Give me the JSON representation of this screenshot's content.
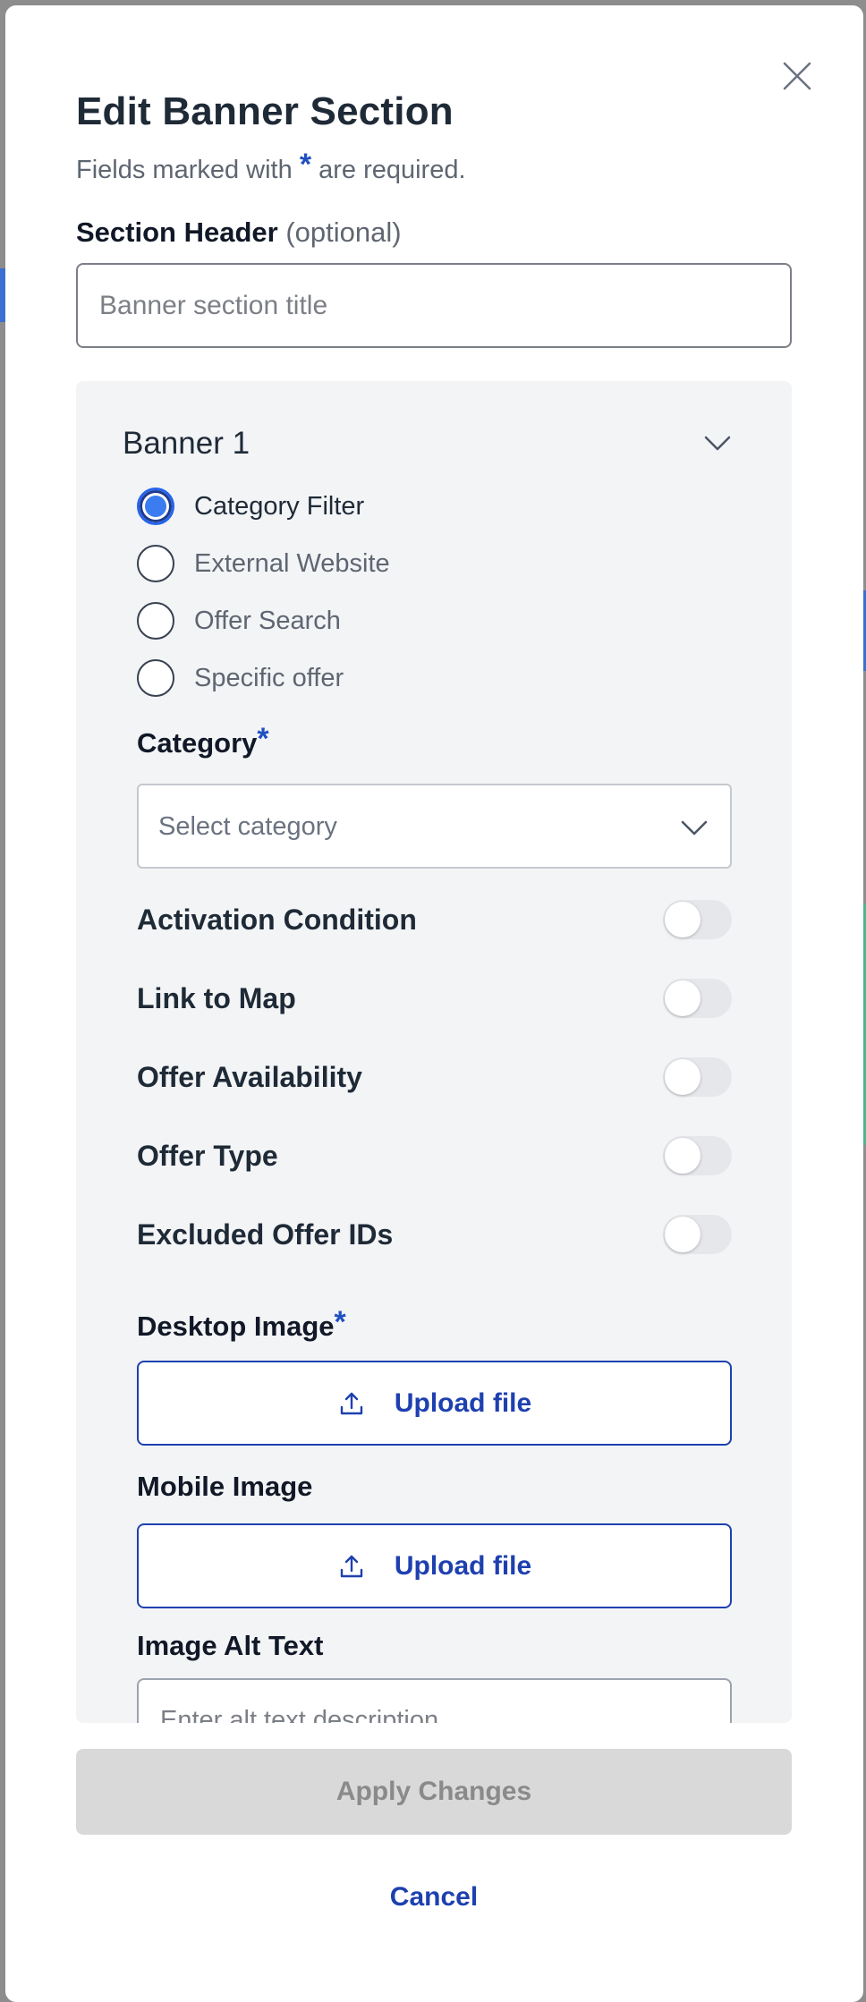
{
  "modal": {
    "title": "Edit Banner Section",
    "subtitle_before": "Fields marked with ",
    "subtitle_star": "*",
    "subtitle_after": " are required."
  },
  "section_header": {
    "label": "Section Header",
    "optional": "(optional)",
    "placeholder": "Banner section title"
  },
  "banner": {
    "title": "Banner 1",
    "radio_options": [
      {
        "label": "Category Filter",
        "checked": true
      },
      {
        "label": "External Website",
        "checked": false
      },
      {
        "label": "Offer Search",
        "checked": false
      },
      {
        "label": "Specific offer",
        "checked": false
      }
    ],
    "category": {
      "label": "Category",
      "required_star": "*",
      "placeholder": "Select category"
    },
    "toggles": [
      {
        "label": "Activation Condition",
        "on": false
      },
      {
        "label": "Link to Map",
        "on": false
      },
      {
        "label": "Offer Availability",
        "on": false
      },
      {
        "label": "Offer Type",
        "on": false
      },
      {
        "label": "Excluded Offer IDs",
        "on": false
      }
    ],
    "desktop_image": {
      "label": "Desktop Image",
      "required_star": "*",
      "button": "Upload file"
    },
    "mobile_image": {
      "label": "Mobile Image",
      "button": "Upload file"
    },
    "alt_text": {
      "label": "Image Alt Text",
      "placeholder": "Enter alt text description"
    }
  },
  "footer": {
    "apply": "Apply Changes",
    "cancel": "Cancel"
  },
  "colors": {
    "accent": "#1e40af",
    "radio_checked": "#3b7cf0",
    "title": "#1f2a37",
    "panel_bg": "#f3f4f6",
    "disabled_bg": "#d9d9d9"
  }
}
